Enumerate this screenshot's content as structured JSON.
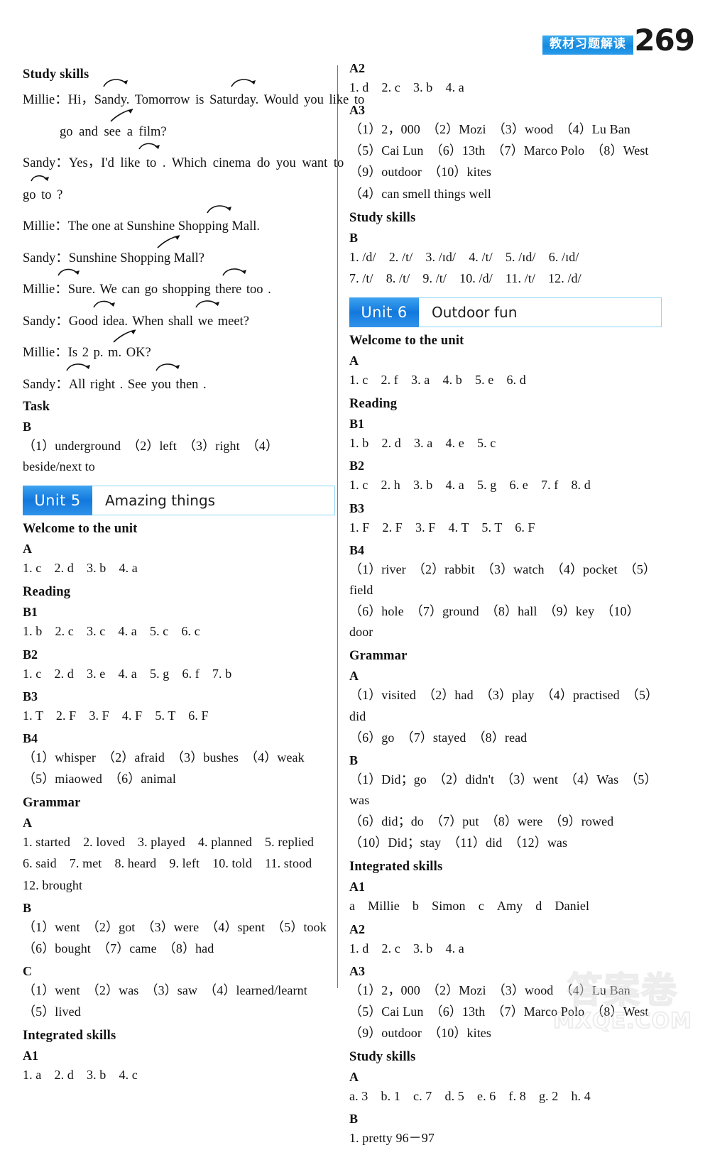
{
  "header": {
    "banner_cn": "教材习题解读",
    "page_number": "269"
  },
  "left_column": {
    "study_skills_heading": "Study skills",
    "dialogue": [
      {
        "speaker": "Millie：",
        "text": "Hi，Sandy. Tomorrow is Saturday. Would you like to"
      },
      {
        "speaker": "",
        "text": "go and see a film?"
      },
      {
        "speaker": "Sandy：",
        "text": "Yes，I'd like  to . Which cinema do you want to"
      },
      {
        "speaker": "",
        "text": "go  to ?"
      },
      {
        "speaker": "Millie：",
        "text": "The one at Sunshine Shopping Mall."
      },
      {
        "speaker": "Sandy：",
        "text": "Sunshine Shopping Mall?"
      },
      {
        "speaker": "Millie：",
        "text": "Sure. We can go shopping there  too ."
      },
      {
        "speaker": "Sandy：",
        "text": "Good idea. When shall we meet?"
      },
      {
        "speaker": "Millie：",
        "text": "Is 2 p. m.  OK?"
      },
      {
        "speaker": "Sandy：",
        "text": "All  right . See you  then ."
      }
    ],
    "task_heading": "Task",
    "task_b_label": "B",
    "task_b_answer": "（1）underground　（2）left　（3）right　（4）beside/next to",
    "unit": {
      "chip": "Unit 5",
      "title": "Amazing things"
    },
    "welcome_heading": "Welcome to the unit",
    "welcome_a_label": "A",
    "welcome_a_answer": "1. c　2. d　3. b　4. a",
    "reading_heading": "Reading",
    "b1_label": "B1",
    "b1_answer": "1. b　2. c　3. c　4. a　5. c　6. c",
    "b2_label": "B2",
    "b2_answer": "1. c　2. d　3. e　4. a　5. g　6. f　7. b",
    "b3_label": "B3",
    "b3_answer": "1. T　2. F　3. F　4. F　5. T　6. F",
    "b4_label": "B4",
    "b4_answer_1": "（1）whisper　（2）afraid　（3）bushes　（4）weak",
    "b4_answer_2": "（5）miaowed　（6）animal",
    "grammar_heading": "Grammar",
    "grammar_a_label": "A",
    "grammar_a_answer_1": "1. started　2. loved　3. played　4. planned　5. replied",
    "grammar_a_answer_2": "6. said　7. met　8. heard　9. left　10. told　11. stood",
    "grammar_a_answer_3": "12. brought",
    "grammar_b_label": "B",
    "grammar_b_answer_1": "（1）went　（2）got　（3）were　（4）spent　（5）took",
    "grammar_b_answer_2": "（6）bought　（7）came　（8）had",
    "grammar_c_label": "C",
    "grammar_c_answer_1": "（1）went　（2）was　（3）saw　（4）learned/learnt",
    "grammar_c_answer_2": "（5）lived",
    "integrated_heading": "Integrated skills",
    "a1_label": "A1",
    "a1_answer": "1. a　2. d　3. b　4. c"
  },
  "right_column": {
    "a2_label": "A2",
    "a2_answer": "1. d　2. c　3. b　4. a",
    "a3_label": "A3",
    "a3_answer_1": "（1）2，000　（2）Mozi　（3）wood　（4）Lu Ban",
    "a3_answer_2": "（5）Cai Lun　（6）13th　（7）Marco Polo　（8）West",
    "a3_answer_3": "（9）outdoor　（10）kites",
    "a3_answer_4": "（4）can smell things well",
    "study_skills_heading": "Study skills",
    "study_b_label": "B",
    "study_b_answer_1": "1. /d/　2. /t/　3. /ɪd/　4. /t/　5. /ɪd/　6. /ɪd/",
    "study_b_answer_2": "7. /t/　8. /t/　9. /t/　10. /d/　11. /t/　12. /d/",
    "unit": {
      "chip": "Unit 6",
      "title": "Outdoor fun"
    },
    "welcome_heading": "Welcome to the unit",
    "welcome_a_label": "A",
    "welcome_a_answer": "1. c　2. f　3. a　4. b　5. e　6. d",
    "reading_heading": "Reading",
    "b1_label": "B1",
    "b1_answer": "1. b　2. d　3. a　4. e　5. c",
    "b2_label": "B2",
    "b2_answer": "1. c　2. h　3. b　4. a　5. g　6. e　7. f　8. d",
    "b3_label": "B3",
    "b3_answer": "1. F　2. F　3. F　4. T　5. T　6. F",
    "b4_label": "B4",
    "b4_answer_1": "（1）river　（2）rabbit　（3）watch　（4）pocket　（5）field",
    "b4_answer_2": "（6）hole　（7）ground　（8）hall　（9）key　（10）door",
    "grammar_heading": "Grammar",
    "grammar_a_label": "A",
    "grammar_a_answer_1": "（1）visited　（2）had　（3）play　（4）practised　（5）did",
    "grammar_a_answer_2": "（6）go　（7）stayed　（8）read",
    "grammar_b_label": "B",
    "grammar_b_answer_1": "（1）Did；go　（2）didn't　（3）went　（4）Was　（5）was",
    "grammar_b_answer_2": "（6）did；do　（7）put　（8）were　（9）rowed",
    "grammar_b_answer_3": "（10）Did；stay　（11）did　（12）was",
    "integrated_heading": "Integrated skills",
    "a1_label": "A1",
    "a1_answer": "a　Millie　b　Simon　c　Amy　d　Daniel",
    "study_a_label": "A",
    "study_a_answer": "a. 3　b. 1　c. 7　d. 5　e. 6　f. 8　g. 2　h. 4",
    "study_b_answer": "1. pretty 96－97"
  },
  "watermark": {
    "cn": "答案卷",
    "en": "MXQE.COM"
  },
  "colors": {
    "banner_blue": "#1b9ae8",
    "chip_blue": "#1f8ae8",
    "chip_border": "#8ed8f8"
  }
}
